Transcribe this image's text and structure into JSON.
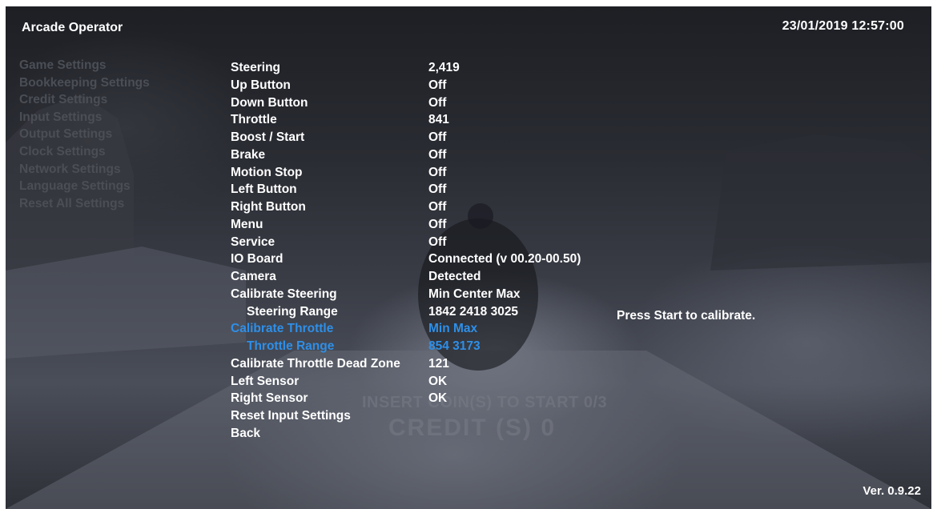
{
  "header": {
    "title": "Arcade Operator",
    "datetime": "23/01/2019  12:57:00"
  },
  "sidebar": {
    "items": [
      {
        "label": "Game Settings"
      },
      {
        "label": "Bookkeeping Settings"
      },
      {
        "label": "Credit Settings"
      },
      {
        "label": "Input Settings"
      },
      {
        "label": "Output Settings"
      },
      {
        "label": "Clock Settings"
      },
      {
        "label": "Network Settings"
      },
      {
        "label": "Language Settings"
      },
      {
        "label": "Reset All Settings"
      }
    ]
  },
  "input_settings": {
    "rows": [
      {
        "label": "Steering",
        "value": "2,419"
      },
      {
        "label": "Up Button",
        "value": "Off"
      },
      {
        "label": "Down Button",
        "value": "Off"
      },
      {
        "label": "Throttle",
        "value": "841"
      },
      {
        "label": "Boost / Start",
        "value": "Off"
      },
      {
        "label": "Brake",
        "value": "Off"
      },
      {
        "label": "Motion Stop",
        "value": "Off"
      },
      {
        "label": "Left Button",
        "value": "Off"
      },
      {
        "label": "Right Button",
        "value": "Off"
      },
      {
        "label": "Menu",
        "value": "Off"
      },
      {
        "label": "Service",
        "value": "Off"
      },
      {
        "label": "IO Board",
        "value": "Connected (v 00.20-00.50)"
      },
      {
        "label": "Camera",
        "value": "Detected"
      },
      {
        "label": "Calibrate Steering",
        "value": "Min Center Max"
      },
      {
        "label": "Steering Range",
        "value": "1842 2418 3025"
      },
      {
        "label": "Calibrate Throttle",
        "value": "Min Max"
      },
      {
        "label": "Throttle Range",
        "value": "854 3173"
      },
      {
        "label": "Calibrate Throttle Dead Zone",
        "value": "121"
      },
      {
        "label": "Left Sensor",
        "value": "OK"
      },
      {
        "label": "Right Sensor",
        "value": "OK"
      },
      {
        "label": "Reset Input Settings",
        "value": ""
      },
      {
        "label": "Back",
        "value": ""
      }
    ],
    "calibration_message": "Press Start to calibrate."
  },
  "background_overlay": {
    "insert_coins": "INSERT COIN(S) TO START 0/3",
    "credit": "CREDIT (S)  0"
  },
  "footer": {
    "version": "Ver. 0.9.22"
  },
  "colors": {
    "highlight": "#2e8fe8",
    "text": "#ffffff",
    "inactive_menu": "#4b4e55"
  }
}
